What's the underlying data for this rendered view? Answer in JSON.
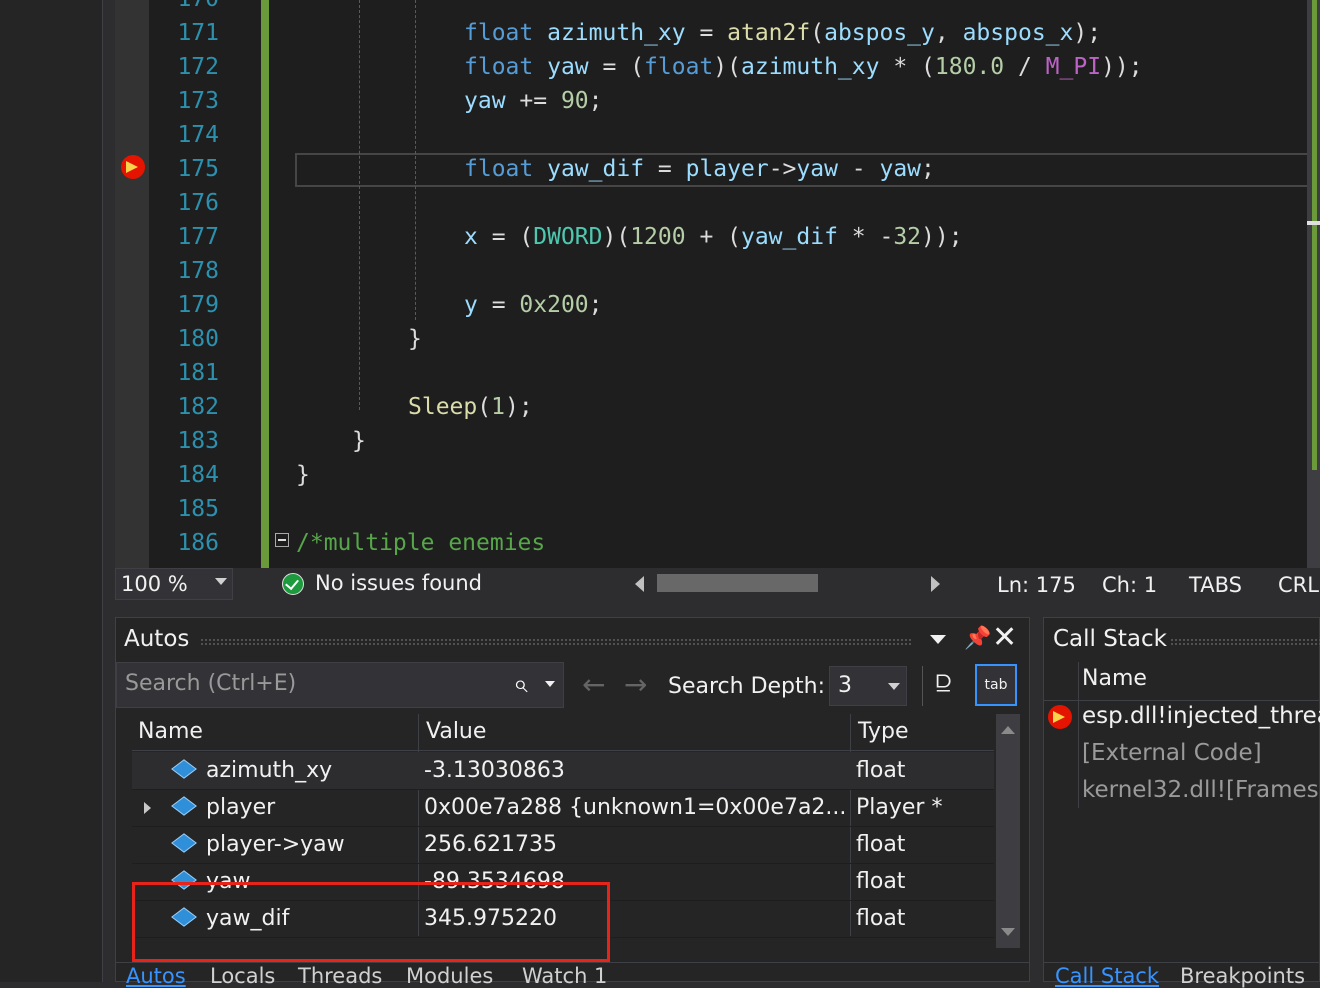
{
  "editor": {
    "lines": [
      {
        "num": "170",
        "parts": []
      },
      {
        "num": "171",
        "parts": [
          [
            "kw",
            "float"
          ],
          [
            "punc",
            " "
          ],
          [
            "var",
            "azimuth_xy"
          ],
          [
            "punc",
            " = "
          ],
          [
            "fn",
            "atan2f"
          ],
          [
            "punc",
            "("
          ],
          [
            "var",
            "abspos_y"
          ],
          [
            "punc",
            ", "
          ],
          [
            "var",
            "abspos_x"
          ],
          [
            "punc",
            ");"
          ]
        ]
      },
      {
        "num": "172",
        "parts": [
          [
            "kw",
            "float"
          ],
          [
            "punc",
            " "
          ],
          [
            "var",
            "yaw"
          ],
          [
            "punc",
            " = ("
          ],
          [
            "kw",
            "float"
          ],
          [
            "punc",
            ")("
          ],
          [
            "var",
            "azimuth_xy"
          ],
          [
            "punc",
            " * ("
          ],
          [
            "num",
            "180.0"
          ],
          [
            "punc",
            " / "
          ],
          [
            "mac",
            "M_PI"
          ],
          [
            "punc",
            "));"
          ]
        ]
      },
      {
        "num": "173",
        "parts": [
          [
            "var",
            "yaw"
          ],
          [
            "punc",
            " += "
          ],
          [
            "num",
            "90"
          ],
          [
            "punc",
            ";"
          ]
        ]
      },
      {
        "num": "174",
        "parts": []
      },
      {
        "num": "175",
        "parts": [
          [
            "kw",
            "float"
          ],
          [
            "punc",
            " "
          ],
          [
            "var",
            "yaw_dif"
          ],
          [
            "punc",
            " = "
          ],
          [
            "var",
            "player"
          ],
          [
            "punc",
            "->"
          ],
          [
            "var",
            "yaw"
          ],
          [
            "punc",
            " - "
          ],
          [
            "var",
            "yaw"
          ],
          [
            "punc",
            ";"
          ]
        ]
      },
      {
        "num": "176",
        "parts": []
      },
      {
        "num": "177",
        "parts": [
          [
            "var",
            "x"
          ],
          [
            "punc",
            " = ("
          ],
          [
            "ty",
            "DWORD"
          ],
          [
            "punc",
            ")("
          ],
          [
            "num",
            "1200"
          ],
          [
            "punc",
            " + ("
          ],
          [
            "var",
            "yaw_dif"
          ],
          [
            "punc",
            " * -"
          ],
          [
            "num",
            "32"
          ],
          [
            "punc",
            "));"
          ]
        ]
      },
      {
        "num": "178",
        "parts": []
      },
      {
        "num": "179",
        "parts": [
          [
            "var",
            "y"
          ],
          [
            "punc",
            " = "
          ],
          [
            "num",
            "0x200"
          ],
          [
            "punc",
            ";"
          ]
        ]
      },
      {
        "num": "180",
        "parts": [
          [
            "punc",
            "}"
          ]
        ]
      },
      {
        "num": "181",
        "parts": []
      },
      {
        "num": "182",
        "parts": [
          [
            "fn",
            "Sleep"
          ],
          [
            "punc",
            "("
          ],
          [
            "num",
            "1"
          ],
          [
            "punc",
            ");"
          ]
        ]
      },
      {
        "num": "183",
        "parts": [
          [
            "punc",
            "}"
          ]
        ]
      },
      {
        "num": "184",
        "parts": [
          [
            "punc",
            "}"
          ]
        ]
      },
      {
        "num": "185",
        "parts": []
      },
      {
        "num": "186",
        "parts": [
          [
            "cm",
            "/*multiple enemies"
          ]
        ]
      }
    ],
    "indents": [
      0,
      3,
      3,
      3,
      0,
      3,
      0,
      3,
      0,
      3,
      2,
      0,
      2,
      1,
      0,
      0,
      0
    ]
  },
  "status": {
    "zoom": "100 %",
    "issues": "No issues found",
    "ln": "Ln: 175",
    "ch": "Ch: 1",
    "tabs": "TABS",
    "eol": "CRLF"
  },
  "autos": {
    "title": "Autos",
    "search_placeholder": "Search (Ctrl+E)",
    "search_depth_label": "Search Depth:",
    "search_depth_value": "3",
    "columns": [
      "Name",
      "Value",
      "Type"
    ],
    "rows": [
      {
        "name": "azimuth_xy",
        "value": "-3.13030863",
        "type": "float",
        "expandable": false
      },
      {
        "name": "player",
        "value": "0x00e7a288 {unknown1=0x00e7a2...",
        "type": "Player *",
        "expandable": true
      },
      {
        "name": "player->yaw",
        "value": "256.621735",
        "type": "float",
        "expandable": false
      },
      {
        "name": "yaw",
        "value": "-89.3534698",
        "type": "float",
        "expandable": false
      },
      {
        "name": "yaw_dif",
        "value": "345.975220",
        "type": "float",
        "expandable": false
      }
    ],
    "tabs": [
      "Autos",
      "Locals",
      "Threads",
      "Modules",
      "Watch 1"
    ]
  },
  "callstack": {
    "title": "Call Stack",
    "column": "Name",
    "rows": [
      "esp.dll!injected_thread",
      "[External Code]",
      "kernel32.dll![Frames"
    ],
    "tabs": [
      "Call Stack",
      "Breakpoints"
    ]
  },
  "colors": {
    "accent": "#3794ff",
    "breakpoint": "#e51400",
    "highlight": "#e8231a"
  }
}
